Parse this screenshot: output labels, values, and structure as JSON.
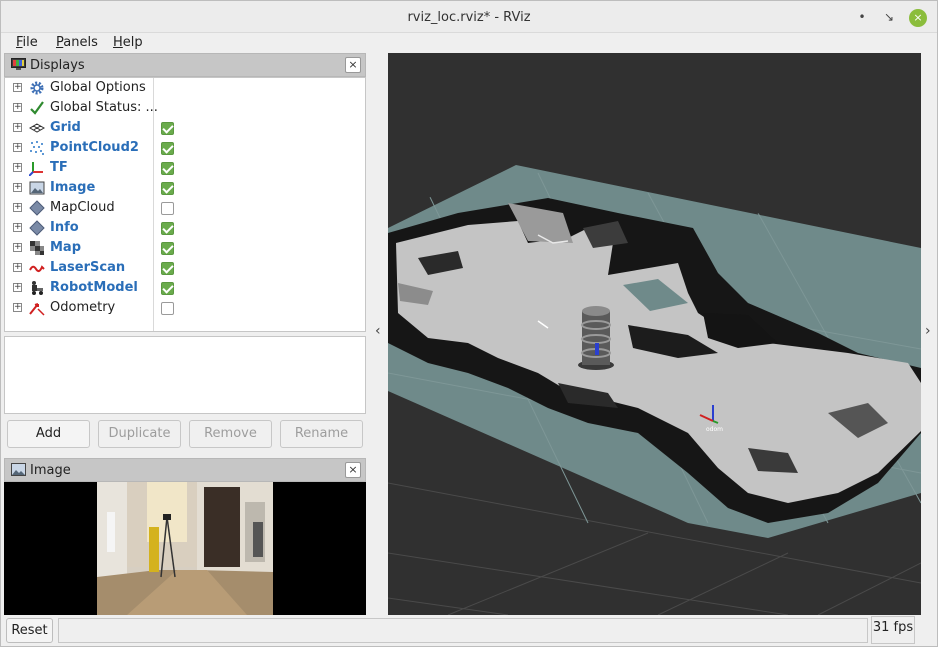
{
  "window": {
    "title": "rviz_loc.rviz* - RViz",
    "minimize_glyph": "•",
    "maximize_glyph": "↘",
    "close_glyph": "×"
  },
  "menu": [
    {
      "label": "File",
      "mnemonic": "F",
      "rest": "ile"
    },
    {
      "label": "Panels",
      "mnemonic": "P",
      "rest": "anels"
    },
    {
      "label": "Help",
      "mnemonic": "H",
      "rest": "elp"
    }
  ],
  "displays_panel": {
    "title": "Displays",
    "close_glyph": "×",
    "items": [
      {
        "label": "Global Options",
        "icon": "gear-icon",
        "checkbox": null,
        "enabled": false
      },
      {
        "label": "Global Status: ...",
        "icon": "checkmark-icon",
        "checkbox": null,
        "enabled": false
      },
      {
        "label": "Grid",
        "icon": "grid-icon",
        "checkbox": true,
        "enabled": true
      },
      {
        "label": "PointCloud2",
        "icon": "pointcloud-icon",
        "checkbox": true,
        "enabled": true
      },
      {
        "label": "TF",
        "icon": "axes-icon",
        "checkbox": true,
        "enabled": true
      },
      {
        "label": "Image",
        "icon": "image-icon",
        "checkbox": true,
        "enabled": true
      },
      {
        "label": "MapCloud",
        "icon": "diamond-icon",
        "checkbox": false,
        "enabled": false
      },
      {
        "label": "Info",
        "icon": "diamond-icon",
        "checkbox": true,
        "enabled": true
      },
      {
        "label": "Map",
        "icon": "map-icon",
        "checkbox": true,
        "enabled": true
      },
      {
        "label": "LaserScan",
        "icon": "laserscan-icon",
        "checkbox": true,
        "enabled": true
      },
      {
        "label": "RobotModel",
        "icon": "robot-icon",
        "checkbox": true,
        "enabled": true
      },
      {
        "label": "Odometry",
        "icon": "odometry-icon",
        "checkbox": false,
        "enabled": false
      }
    ],
    "buttons": {
      "add": "Add",
      "duplicate": "Duplicate",
      "remove": "Remove",
      "rename": "Rename"
    }
  },
  "image_panel": {
    "title": "Image",
    "close_glyph": "×"
  },
  "view3d": {
    "left_arrow": "‹",
    "right_arrow": "›",
    "frame_label": "odom"
  },
  "bottom": {
    "reset": "Reset",
    "fps": "31 fps"
  }
}
